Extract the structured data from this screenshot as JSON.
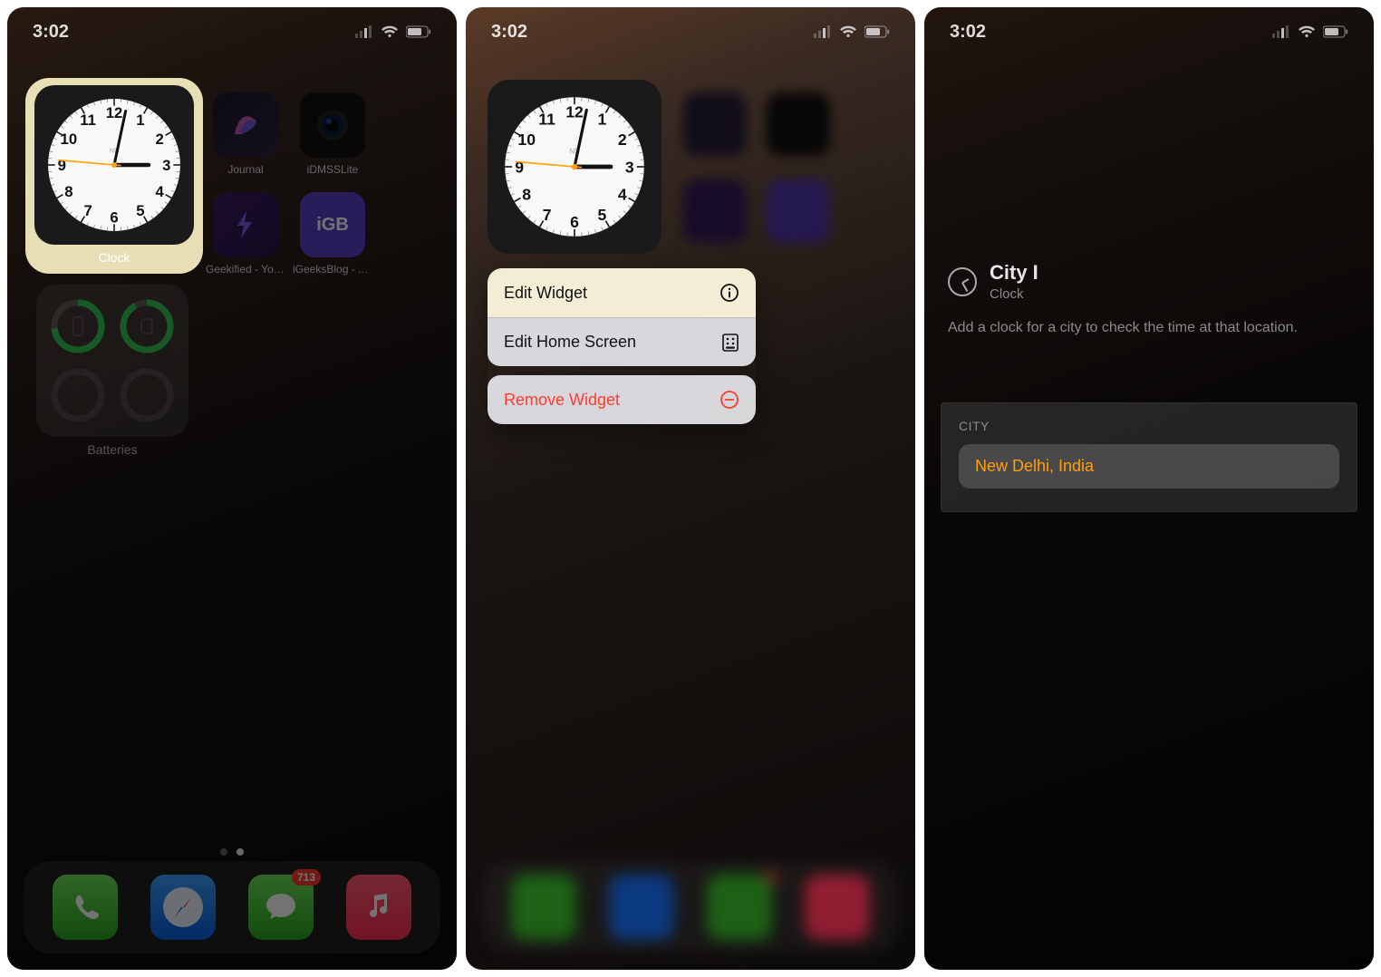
{
  "status": {
    "time": "3:02"
  },
  "clock": {
    "widget_label": "Clock",
    "face_text": "ND",
    "hour_angle": 90,
    "minute_angle": 12,
    "second_angle": 275
  },
  "panel1": {
    "apps_row1": [
      {
        "name": "journal",
        "label": "Journal"
      },
      {
        "name": "idmsslite",
        "label": "iDMSSLite"
      }
    ],
    "apps_row2": [
      {
        "name": "geekified",
        "label": "Geekified - You…"
      },
      {
        "name": "igeeks",
        "label": "iGeeksBlog - All…"
      }
    ],
    "batteries_label": "Batteries",
    "dock_badge": "713"
  },
  "panel2": {
    "menu": {
      "edit_widget": "Edit Widget",
      "edit_home": "Edit Home Screen",
      "remove": "Remove Widget"
    }
  },
  "panel3": {
    "title": "City I",
    "subtitle": "Clock",
    "description": "Add a clock for a city to check the time at that location.",
    "section_label": "CITY",
    "city_value": "New Delhi, India"
  }
}
